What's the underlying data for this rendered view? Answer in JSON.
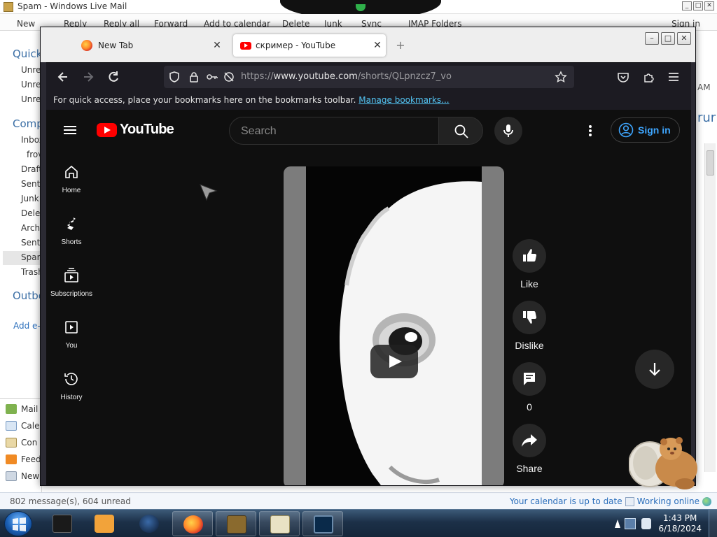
{
  "mail": {
    "title": "Spam - Windows Live Mail",
    "ribbon": [
      "New",
      "Reply",
      "Reply all",
      "Forward",
      "Add to calendar",
      "Delete",
      "Junk",
      "Sync",
      "IMAP Folders"
    ],
    "sign_in": "Sign in",
    "nav": {
      "quick_views": "Quick",
      "quick_items": [
        "Unrea",
        "Unrea",
        "Unrea"
      ],
      "computer": "Comp",
      "folders": [
        "Inbox",
        "frov",
        "Draft",
        "Sent",
        "Junk",
        "Delet",
        "Archi",
        "Sent",
        "Spam",
        "Trash"
      ],
      "outbox": "Outbo",
      "add_account": "Add e-",
      "modules": [
        "Mail",
        "Cale",
        "Con",
        "Feed",
        "New"
      ]
    },
    "peek": {
      "time": "AM",
      "subject": "rur"
    },
    "status_left": "802 message(s), 604 unread",
    "status_calendar": "Your calendar is up to date",
    "status_online": "Working online"
  },
  "browser": {
    "tabs": [
      {
        "label": "New Tab"
      },
      {
        "label": "скример - YouTube"
      }
    ],
    "url_prefix": "https://",
    "url_host": "www.youtube.com",
    "url_path": "/shorts/QLpnzcz7_vo",
    "bookmarks_text": "For quick access, place your bookmarks here on the bookmarks toolbar.",
    "bookmarks_link": "Manage bookmarks..."
  },
  "youtube": {
    "logo": "YouTube",
    "search_placeholder": "Search",
    "sign_in": "Sign in",
    "sidebar": [
      "Home",
      "Shorts",
      "Subscriptions",
      "You",
      "History"
    ],
    "actions": {
      "like": "Like",
      "dislike": "Dislike",
      "comments": "0",
      "share": "Share"
    }
  },
  "taskbar": {
    "time": "1:43 PM",
    "date": "6/18/2024"
  },
  "colors": {
    "yt_red": "#ff0000",
    "yt_bg": "#0f0f0f",
    "yt_blue": "#3ea6ff",
    "ff_toolbar": "#1c1b22",
    "ff_link": "#54c6f5"
  }
}
